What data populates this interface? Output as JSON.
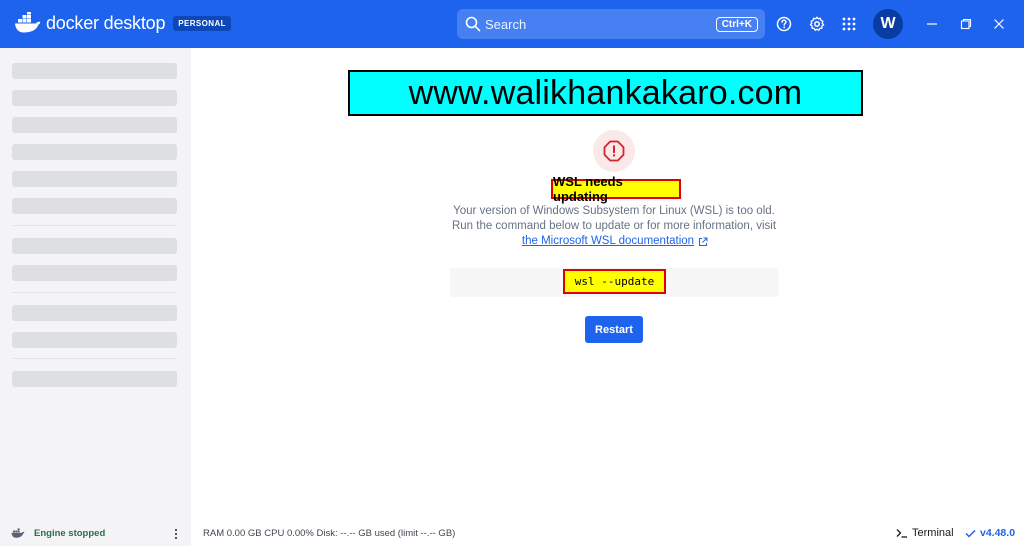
{
  "app": {
    "brand_name": "docker desktop",
    "plan_badge": "PERSONAL",
    "accent_color": "#1d63ed"
  },
  "titlebar": {
    "search_placeholder": "Search",
    "search_shortcut": "Ctrl+K",
    "icons": [
      "help-icon",
      "settings-icon",
      "apps-grid-icon"
    ],
    "avatar_initial": "W",
    "window_controls": [
      "minimize-icon",
      "restore-icon",
      "close-icon"
    ]
  },
  "overlay": {
    "watermark_text": "www.walikhankakaro.com"
  },
  "dialog": {
    "icon": "error-icon",
    "title": "WSL needs updating",
    "desc_line1": "Your version of Windows Subsystem for Linux (WSL) is too old.",
    "desc_line2": "Run the command below to update or for more information, visit",
    "desc_link": "the Microsoft WSL documentation",
    "command": "wsl --update",
    "restart_label": "Restart"
  },
  "footer": {
    "engine_status": "Engine stopped",
    "stats": "RAM 0.00 GB   CPU 0.00%   Disk: --.-- GB used (limit --.-- GB)",
    "terminal_label": "Terminal",
    "version": "v4.48.0"
  }
}
